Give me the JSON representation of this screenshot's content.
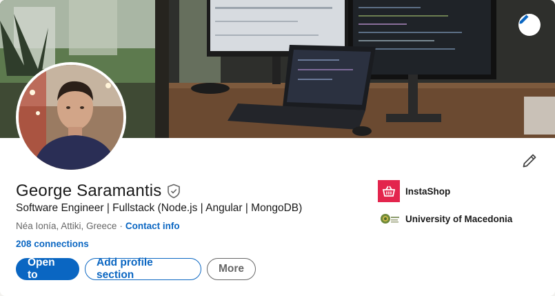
{
  "profile": {
    "name": "George Saramantis",
    "headline": "Software Engineer | Fullstack (Node.js | Angular | MongoDB)",
    "location": "Néa Ionía, Attiki, Greece",
    "separator": "·",
    "contact_label": "Contact info",
    "connections": "208 connections"
  },
  "actions": {
    "open_to": "Open to",
    "add_section": "Add profile section",
    "more": "More"
  },
  "experience": [
    {
      "name": "InstaShop",
      "icon": "basket-icon",
      "color": "#e3254d"
    },
    {
      "name": "University of Macedonia",
      "icon": "university-seal-icon",
      "color": "#6f8a3a"
    }
  ],
  "colors": {
    "accent": "#0a66c2",
    "text": "#191919",
    "muted": "#666666"
  }
}
